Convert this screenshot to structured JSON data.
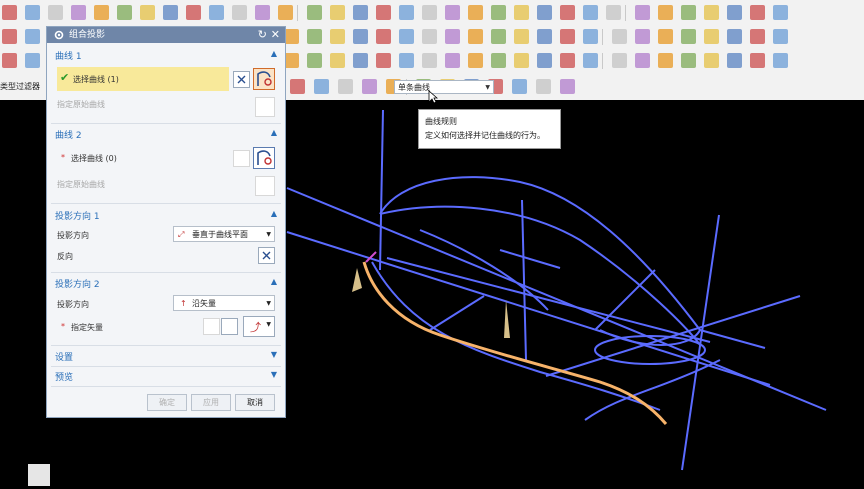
{
  "toolbar": {
    "filter_label": "类型过滤器",
    "rule_select_value": "单条曲线"
  },
  "tooltip": {
    "title": "曲线规则",
    "description": "定义如何选择并记住曲线的行为。"
  },
  "dialog": {
    "title": "组合投影",
    "group_curve1": {
      "header": "曲线 1",
      "select_label": "选择曲线 (1)",
      "origin_label": "指定原始曲线"
    },
    "group_curve2": {
      "header": "曲线 2",
      "select_label": "选择曲线 (0)",
      "origin_label": "指定原始曲线"
    },
    "group_dir1": {
      "header": "投影方向 1",
      "direction_label": "投影方向",
      "direction_value": "垂直于曲线平面",
      "reverse_label": "反向"
    },
    "group_dir2": {
      "header": "投影方向 2",
      "direction_label": "投影方向",
      "direction_value": "沿矢量",
      "vector_label": "指定矢量"
    },
    "settings_label": "设置",
    "preview_label": "预览",
    "ok_label": "确定",
    "apply_label": "应用",
    "cancel_label": "取消"
  },
  "colors": {
    "curve": "#5b6bff",
    "selected_curve": "#f7b36a",
    "viewport_bg": "#000000",
    "dialog_title_bg": "#6f86a8",
    "highlight_row": "#f8e99a",
    "link_blue": "#2a6fb8"
  },
  "icons": [
    "gear-icon",
    "reset-icon",
    "close-icon",
    "check-icon",
    "curve-select-icon",
    "vector-icon",
    "dropdown-icon",
    "cursor-icon"
  ]
}
